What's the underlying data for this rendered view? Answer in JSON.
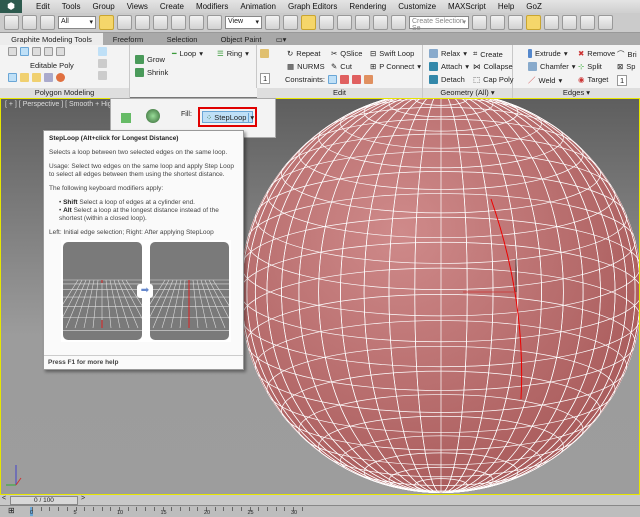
{
  "menu": [
    "Edit",
    "Tools",
    "Group",
    "Views",
    "Create",
    "Modifiers",
    "Animation",
    "Graph Editors",
    "Rendering",
    "Customize",
    "MAXScript",
    "Help",
    "GoZ"
  ],
  "toolbar": {
    "filter_value": "All",
    "refcoord_value": "View",
    "selection_set_placeholder": "Create Selection Se"
  },
  "ribbon_tabs": [
    "Graphite Modeling Tools",
    "Freeform",
    "Selection",
    "Object Paint"
  ],
  "panels": {
    "polygon_modeling": {
      "label": "Polygon Modeling",
      "editable": "Editable Poly",
      "grow": "Grow",
      "shrink": "Shrink",
      "loop": "Loop",
      "ring": "Ring",
      "spinner": "1"
    },
    "edit": {
      "label": "Edit",
      "repeat": "Repeat",
      "qslice": "QSlice",
      "swift_loop": "Swift Loop",
      "nurms": "NURMS",
      "cut": "Cut",
      "p_connect": "P Connect",
      "constraints": "Constraints:",
      "spinner": "1"
    },
    "geometry": {
      "label": "Geometry (All)",
      "relax": "Relax",
      "create": "Create",
      "attach": "Attach",
      "collapse": "Collapse",
      "detach": "Detach",
      "cap_poly": "Cap Poly"
    },
    "edges": {
      "label": "Edges",
      "extrude": "Extrude",
      "remove": "Remove",
      "chamfer": "Chamfer",
      "split": "Split",
      "weld": "Weld",
      "target": "Target",
      "bridge": "Bri",
      "spin": "Sp",
      "spinner": "1"
    }
  },
  "viewport": {
    "label": "[ + ] [ Perspective ] [ Smooth + Highlight"
  },
  "flyout": {
    "fill_label": "Fill:",
    "steploop": "StepLoop"
  },
  "tooltip": {
    "title": "StepLoop  (Alt+click for Longest Distance)",
    "desc": "Selects a loop between two selected edges on the same loop.",
    "usage": "Usage: Select two edges on the same loop and apply Step Loop to select all edges between them using the shortest distance.",
    "modifiers_intro": "The following keyboard modifiers apply:",
    "shift_key": "Shift",
    "shift_desc": " Select a loop of edges at a cylinder end.",
    "alt_key": "Alt",
    "alt_desc": " Select a loop at the longest distance instead of the shortest (within a closed loop).",
    "caption": "Left: Initial edge selection; Right: After applying StepLoop",
    "footer": "Press F1 for more help"
  },
  "timeline": {
    "frame": "0 / 100",
    "ticks": [
      "0",
      "5",
      "10",
      "15",
      "20",
      "25",
      "30"
    ]
  },
  "colors": {
    "sphere": "#c27676",
    "highlight": "#e00000",
    "active_tool": "#f5d66a"
  }
}
